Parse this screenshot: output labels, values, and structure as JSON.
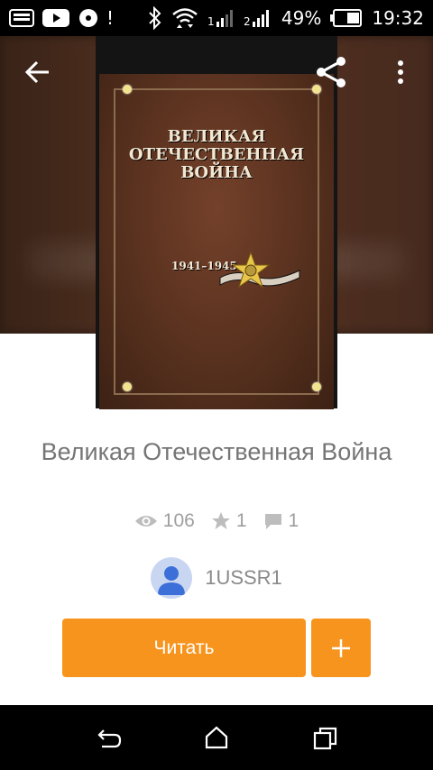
{
  "status_bar": {
    "battery_percent": "49%",
    "time": "19:32",
    "icons": [
      "screen-icon",
      "youtube-icon",
      "media-icon",
      "bluetooth-icon",
      "wifi-icon",
      "signal1-icon",
      "signal2-icon",
      "battery-icon"
    ]
  },
  "cover": {
    "title_line1": "ВЕЛИКАЯ",
    "title_line2": "ОТЕЧЕСТВЕННАЯ",
    "title_line3": "ВОЙНА",
    "years": "1941–1945"
  },
  "book": {
    "title": "Великая Отечественная Война"
  },
  "stats": {
    "views": "106",
    "stars": "1",
    "comments": "1"
  },
  "author": {
    "name": "1USSR1"
  },
  "actions": {
    "read_label": "Читать",
    "add_label": "+"
  },
  "colors": {
    "accent": "#f7941d",
    "text_gray": "#757575",
    "icon_gray": "#9e9e9e"
  }
}
